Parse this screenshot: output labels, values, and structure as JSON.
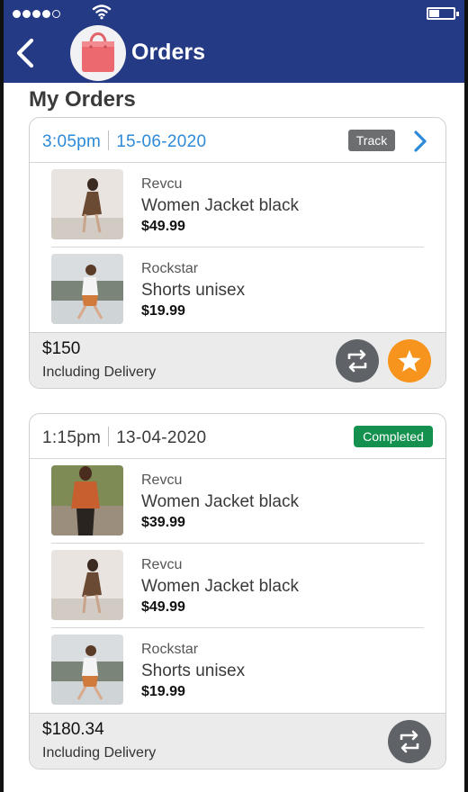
{
  "header": {
    "title": "Orders",
    "background_color": "#253a84",
    "back_icon": "chevron-left-icon",
    "logo_icon": "shopping-bag-icon"
  },
  "status_bar": {
    "signal_dots_filled": 4,
    "signal_dots_total": 5,
    "wifi_icon": "wifi-icon",
    "battery_level": 0.35
  },
  "section_title": "My Orders",
  "orders": [
    {
      "time": "3:05pm",
      "date": "15-06-2020",
      "datetime_color": "#2e8ad8",
      "track_label": "Track",
      "items": [
        {
          "brand": "Revcu",
          "name": "Women Jacket black",
          "price": "$49.99"
        },
        {
          "brand": "Rockstar",
          "name": "Shorts unisex",
          "price": "$19.99"
        }
      ],
      "total": "$150",
      "delivery_note": "Including Delivery",
      "actions": [
        "reorder-icon",
        "star-icon"
      ]
    },
    {
      "time": "1:15pm",
      "date": "13-04-2020",
      "datetime_color": "#3a3a3a",
      "status_label": "Completed",
      "status_color": "#15914f",
      "items": [
        {
          "brand": "Revcu",
          "name": "Women Jacket black",
          "price": "$39.99"
        },
        {
          "brand": "Revcu",
          "name": "Women Jacket black",
          "price": "$49.99"
        },
        {
          "brand": "Rockstar",
          "name": "Shorts unisex",
          "price": "$19.99"
        }
      ],
      "total": "$180.34",
      "delivery_note": "Including Delivery",
      "actions": [
        "reorder-icon"
      ]
    }
  ],
  "colors": {
    "reorder_button": "#5f6368",
    "rate_button": "#f7941d",
    "track_button": "#6d6e70"
  }
}
